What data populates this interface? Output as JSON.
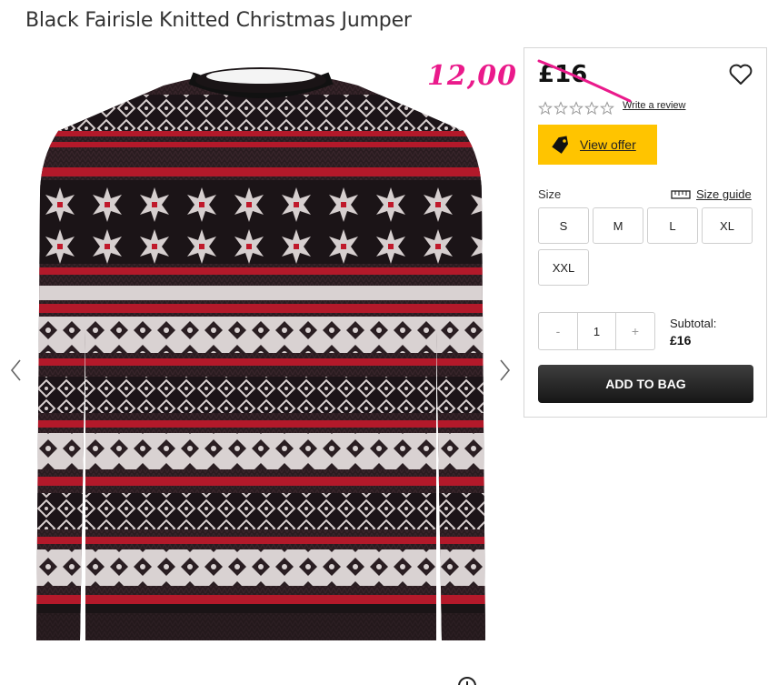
{
  "product": {
    "title": "Black Fairisle Knitted Christmas Jumper",
    "price": "£16",
    "handwritten_price": "12,00",
    "review_link": "Write a review",
    "rating_stars": 0,
    "rating_max": 5
  },
  "offer": {
    "label": "View offer",
    "color": "#ffc400"
  },
  "size": {
    "label": "Size",
    "guide_label": "Size guide",
    "options": [
      "S",
      "M",
      "L",
      "XL",
      "XXL"
    ]
  },
  "quantity": {
    "minus": "-",
    "value": "1",
    "plus": "+"
  },
  "subtotal": {
    "label": "Subtotal:",
    "value": "£16"
  },
  "cart": {
    "add_label": "ADD TO BAG"
  },
  "colors": {
    "accent_pink": "#ea1a8b",
    "offer_yellow": "#ffc400",
    "button_dark": "#1e1e1e"
  },
  "icons": [
    "chevron-left-icon",
    "chevron-right-icon",
    "heart-icon",
    "star-icon",
    "tag-icon",
    "ruler-icon",
    "zoom-icon"
  ]
}
